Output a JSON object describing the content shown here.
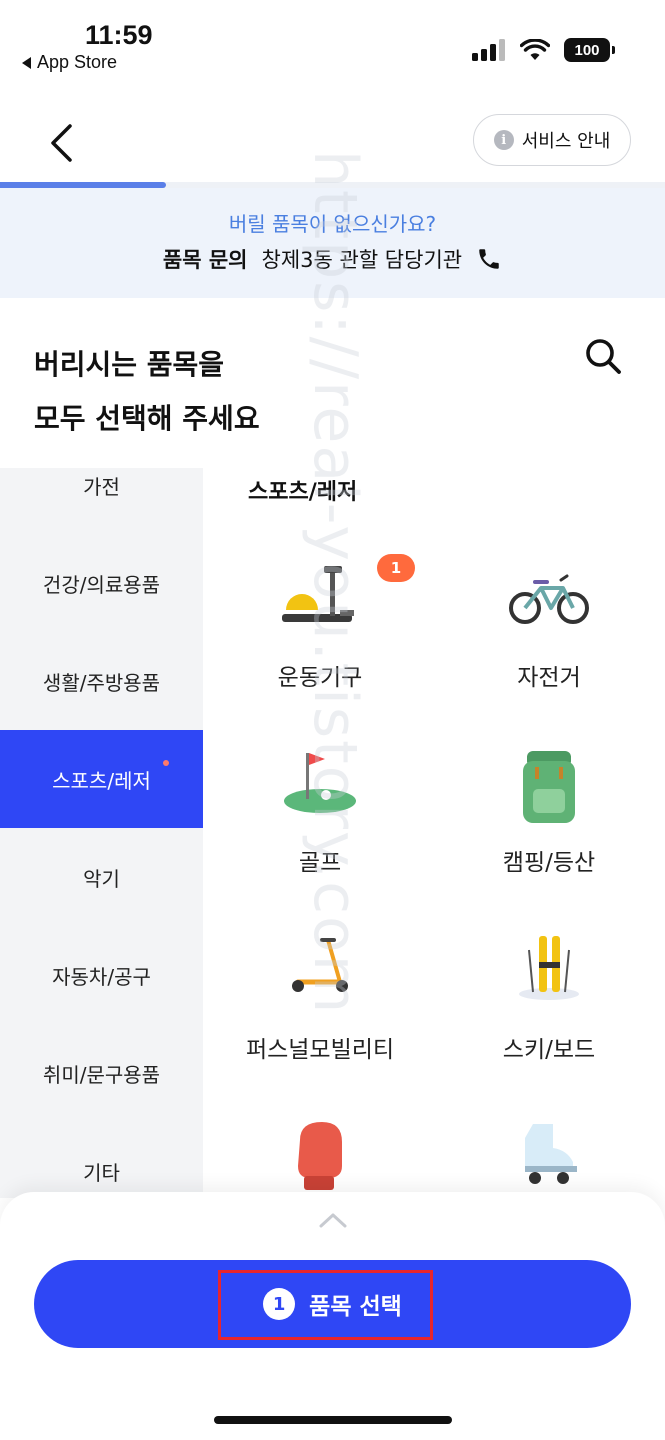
{
  "status_bar": {
    "time": "11:59",
    "back_app": "App Store",
    "battery": "100"
  },
  "header": {
    "service_button": "서비스 안내",
    "progress_fraction": 0.25
  },
  "banner": {
    "question": "버릴 품목이 없으신가요?",
    "inquiry_label": "품목 문의",
    "inquiry_target": "창제3동 관할 담당기관"
  },
  "title": {
    "line1": "버리시는 품목을",
    "line2": "모두 선택해 주세요"
  },
  "sidebar": {
    "items": [
      {
        "label": "가전"
      },
      {
        "label": "건강/의료용품"
      },
      {
        "label": "생활/주방용품"
      },
      {
        "label": "스포츠/레저",
        "active": true
      },
      {
        "label": "악기"
      },
      {
        "label": "자동차/공구"
      },
      {
        "label": "취미/문구용품"
      },
      {
        "label": "기타"
      }
    ]
  },
  "section": {
    "title": "스포츠/레저",
    "items": [
      {
        "label": "운동기구",
        "icon": "treadmill-icon",
        "badge": "1"
      },
      {
        "label": "자전거",
        "icon": "bicycle-icon"
      },
      {
        "label": "골프",
        "icon": "golf-icon"
      },
      {
        "label": "캠핑/등산",
        "icon": "backpack-icon"
      },
      {
        "label": "퍼스널모빌리티",
        "icon": "scooter-icon"
      },
      {
        "label": "스키/보드",
        "icon": "ski-icon"
      },
      {
        "label": "",
        "icon": "boxing-glove-icon"
      },
      {
        "label": "",
        "icon": "roller-skate-icon"
      }
    ]
  },
  "bottom": {
    "count": "1",
    "select_label": "품목 선택"
  },
  "watermark": "https://real-you.tistory.com",
  "colors": {
    "primary": "#2f47f5",
    "banner_bg": "#eef3fb",
    "accent_text": "#4a7fe0",
    "badge": "#ff6a3d",
    "highlight": "#e8252e"
  }
}
